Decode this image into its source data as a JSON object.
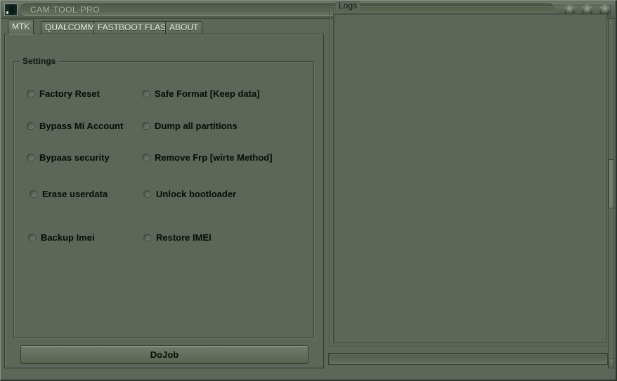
{
  "window": {
    "title": "CAM-TOOL-PRO",
    "app_icon": "app-icon",
    "controls": [
      {
        "name": "minimize-button",
        "glyph": ""
      },
      {
        "name": "maximize-button",
        "glyph": ""
      },
      {
        "name": "close-button",
        "glyph": ""
      }
    ]
  },
  "tabs": [
    {
      "label": "MTK",
      "active": true
    },
    {
      "label": "QUALCOMM",
      "active": false
    },
    {
      "label": "FASTBOOT FLASH",
      "active": false
    },
    {
      "label": "ABOUT",
      "active": false
    }
  ],
  "settings": {
    "title": "Settings",
    "left_column": [
      {
        "label": "Factory  Reset",
        "selected": false
      },
      {
        "label": "Bypass Mi Account",
        "selected": false
      },
      {
        "label": "Bypaas security",
        "selected": false
      },
      {
        "label": "Erase userdata",
        "selected": false
      },
      {
        "label": "Backup Imei",
        "selected": false
      }
    ],
    "right_column": [
      {
        "label": "Safe Format [Keep  data]",
        "selected": false
      },
      {
        "label": "Dump all partitions",
        "selected": false
      },
      {
        "label": "Remove Frp [wirte Method]",
        "selected": false
      },
      {
        "label": "Unlock bootloader",
        "selected": false
      },
      {
        "label": "Restore IMEI",
        "selected": false
      }
    ]
  },
  "actions": {
    "dojob_label": "DoJob"
  },
  "logs": {
    "title": "Logs",
    "content": ""
  },
  "status": {
    "text": ""
  },
  "colors": {
    "window_background": "#5c6659",
    "panel_background": "#5c6659",
    "border_dark": "#2f362d",
    "border_light": "#8a9486",
    "title_text": "#aab6a5",
    "tab_text": "#e7eee4",
    "label_text": "#080c08"
  }
}
